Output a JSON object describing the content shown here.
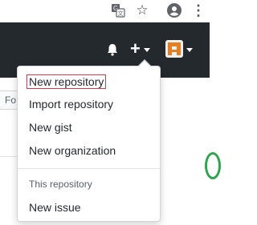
{
  "browser": {
    "icons": [
      "translate-icon",
      "star-icon",
      "account-icon",
      "more-icon"
    ]
  },
  "header": {
    "icons": [
      "bell-icon",
      "plus-icon",
      "avatar-icon"
    ],
    "plus_symbol": "+"
  },
  "page": {
    "partial_button": "Fo"
  },
  "dropdown": {
    "items": [
      {
        "label": "New repository"
      },
      {
        "label": "Import repository"
      },
      {
        "label": "New gist"
      },
      {
        "label": "New organization"
      }
    ],
    "section_header": "This repository",
    "section_items": [
      {
        "label": "New issue"
      }
    ]
  },
  "colors": {
    "header_bg": "#24292e",
    "highlight_outline": "#d73a49",
    "avatar_orange": "#e67e22",
    "green_accent": "#2ea44f"
  }
}
